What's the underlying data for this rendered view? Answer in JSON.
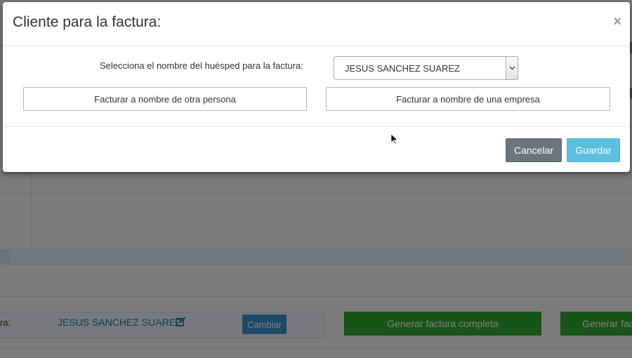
{
  "background": {
    "invoice_label": "ra:",
    "client_name": "JESUS SANCHEZ SUAREZ",
    "change_button": "Cambiar",
    "generate_full_button": "Generar factura completa",
    "generate_partial_button": "Generar fac"
  },
  "modal": {
    "title": "Cliente para la factura:",
    "close_symbol": "×",
    "select_label": "Selecciona el nombre del huésped para la factura:",
    "selected_guest": "JESUS SANCHEZ SUAREZ",
    "other_person_button": "Facturar a nombre de otra persona",
    "company_button": "Facturar a nombre de una empresa",
    "cancel_button": "Cancelar",
    "save_button": "Guardar"
  },
  "colors": {
    "save": "#5bc0de",
    "cancel": "#6c757d",
    "generate": "#2ea82e",
    "change": "#3a95d3"
  }
}
